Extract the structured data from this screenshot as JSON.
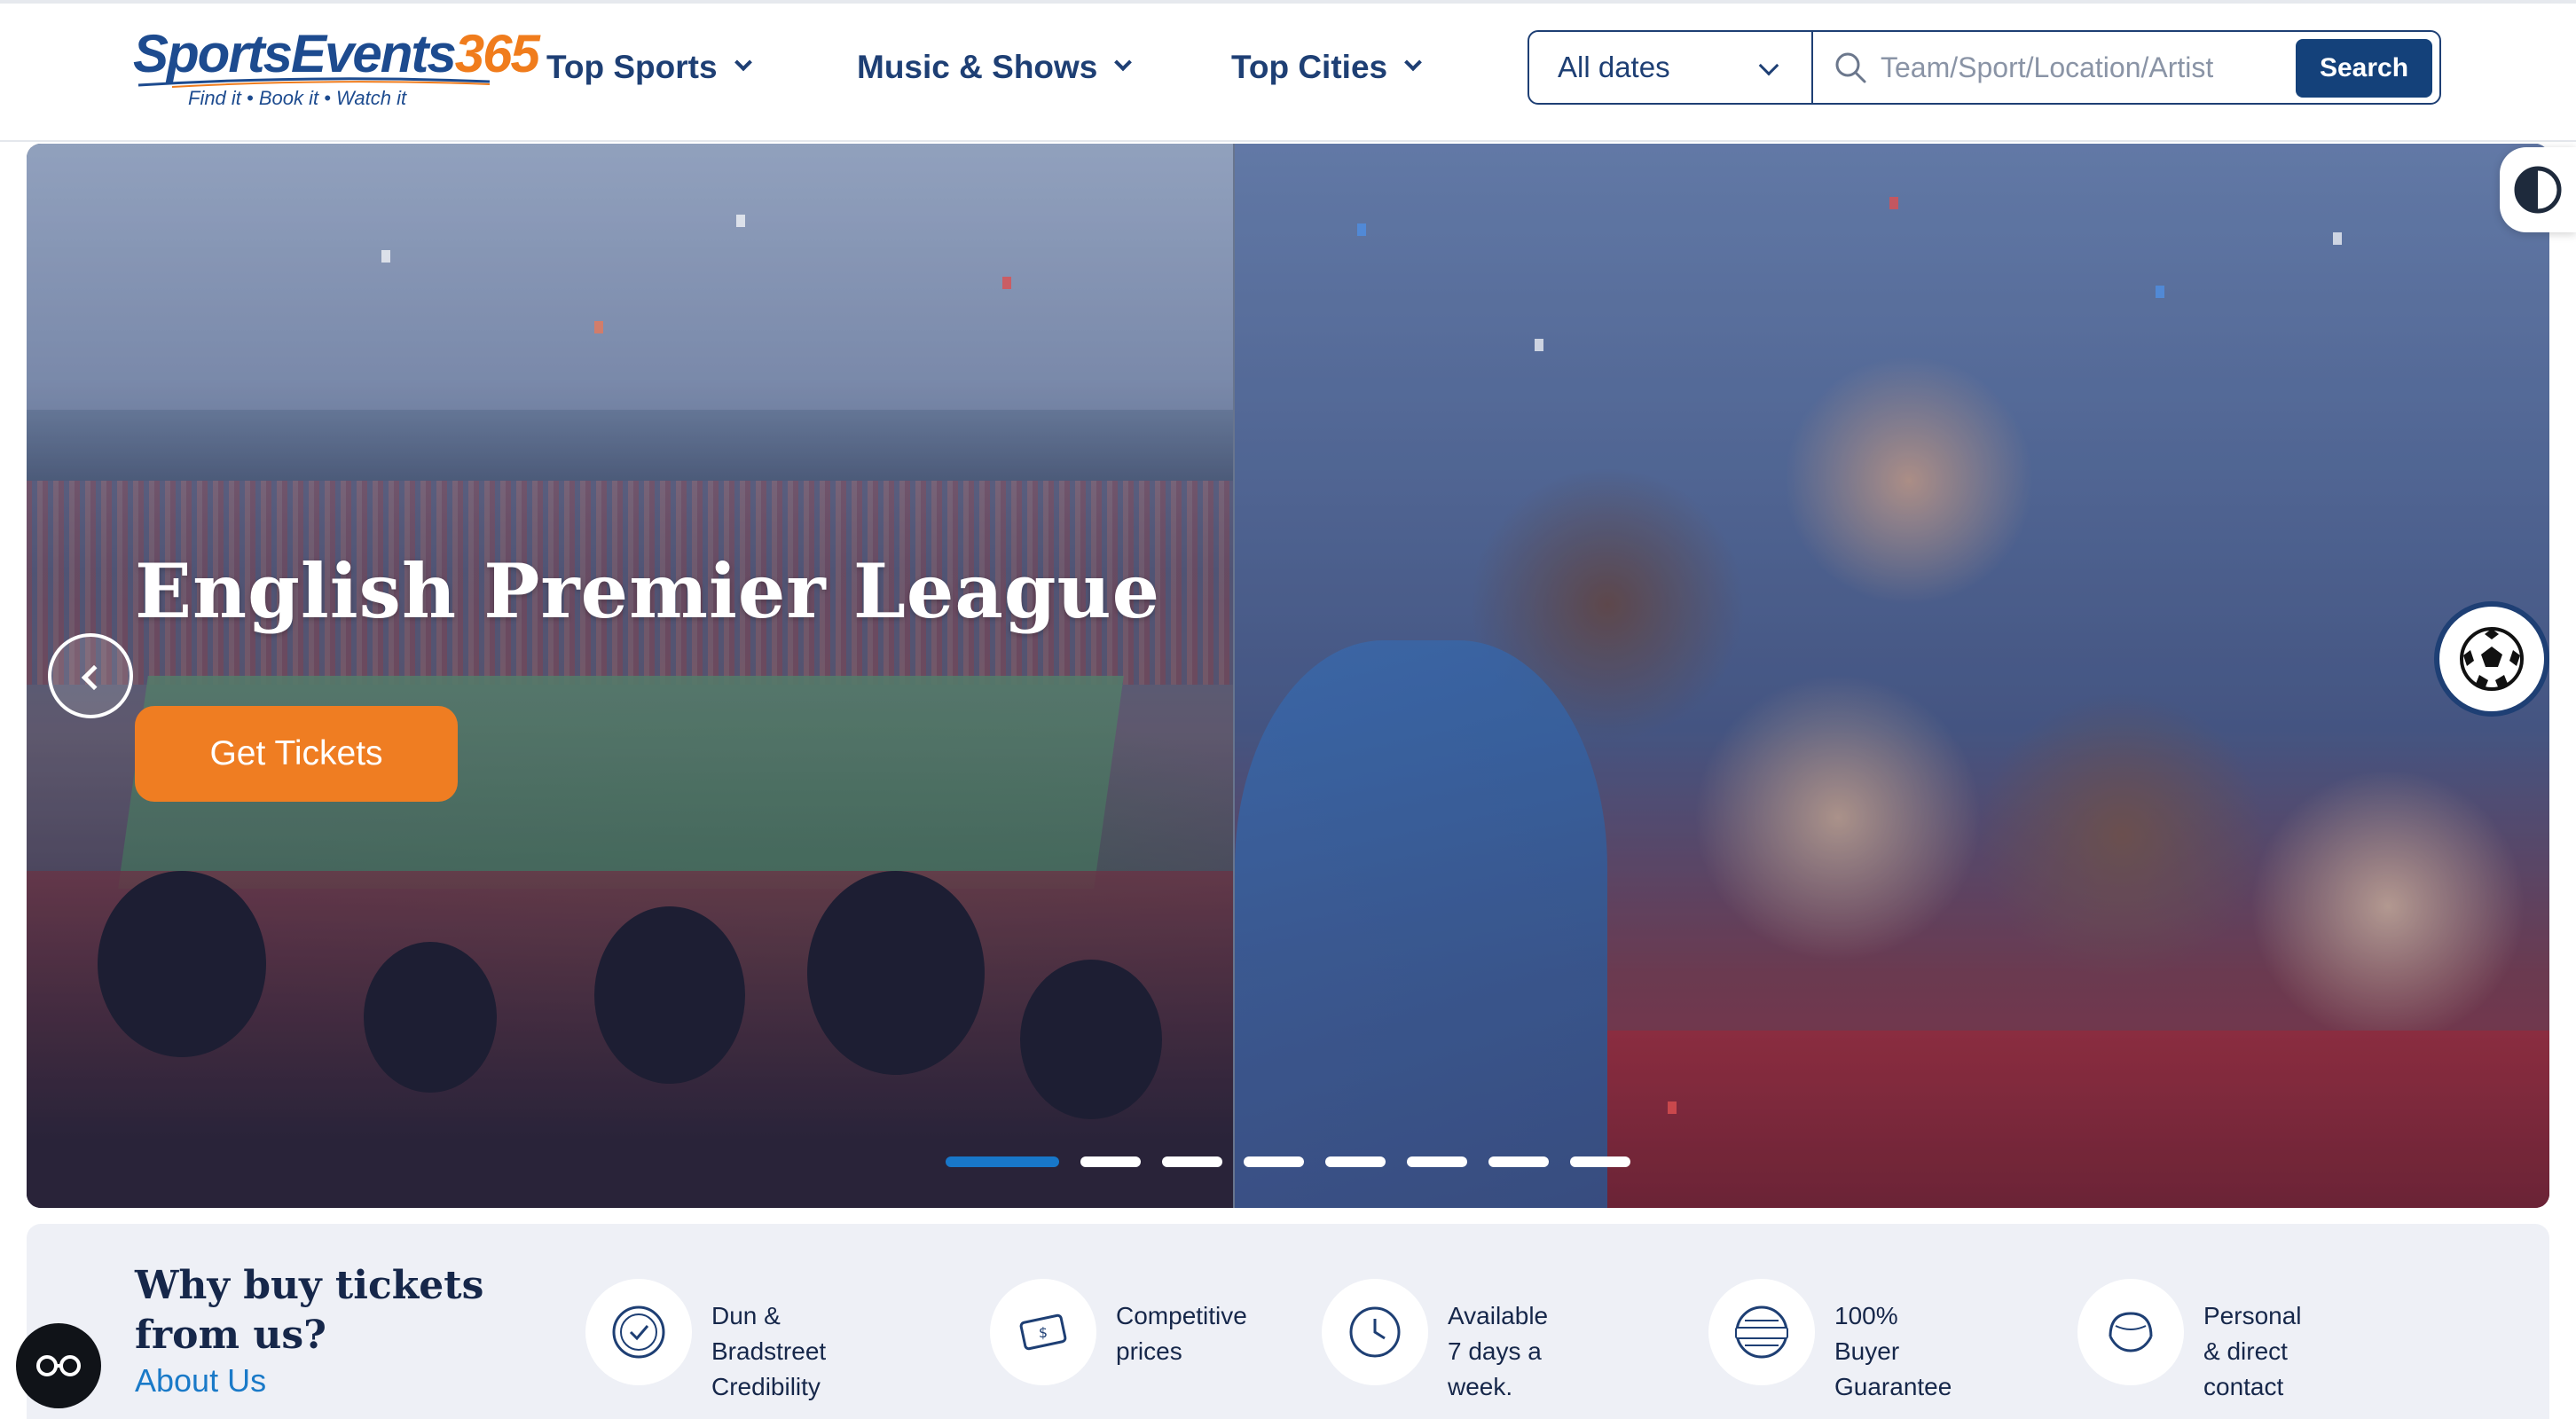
{
  "brand": {
    "name_part1": "SportsEvents",
    "name_part2": "365",
    "tagline": "Find it • Book it • Watch it"
  },
  "nav": {
    "items": [
      {
        "label": "Top Sports"
      },
      {
        "label": "Music & Shows"
      },
      {
        "label": "Top Cities"
      }
    ]
  },
  "search": {
    "dates_value": "All dates",
    "placeholder": "Team/Sport/Location/Artist",
    "button_label": "Search"
  },
  "hero": {
    "title": "English Premier League",
    "cta_label": "Get Tickets",
    "slide_count": 8,
    "active_slide": 1
  },
  "why": {
    "title": "Why buy tickets from us?",
    "link_label": "About Us",
    "features": [
      {
        "line1": "Dun & Bradstreet",
        "line2": "Credibility",
        "icon": "badge-check-icon"
      },
      {
        "line1": "Competitive",
        "line2": "prices",
        "icon": "ticket-price-icon"
      },
      {
        "line1": "Available 7 days a",
        "line2": "week.",
        "icon": "clock-icon"
      },
      {
        "line1": "100% Buyer",
        "line2": "Guarantee",
        "icon": "guarantee-seal-icon"
      },
      {
        "line1": "Personal & direct",
        "line2": "contact",
        "icon": "contact-icon"
      }
    ]
  },
  "colors": {
    "brand_navy": "#1e3f74",
    "accent_orange": "#ef7d22",
    "link_blue": "#1a7ac8",
    "active_dot": "#1877c9"
  }
}
